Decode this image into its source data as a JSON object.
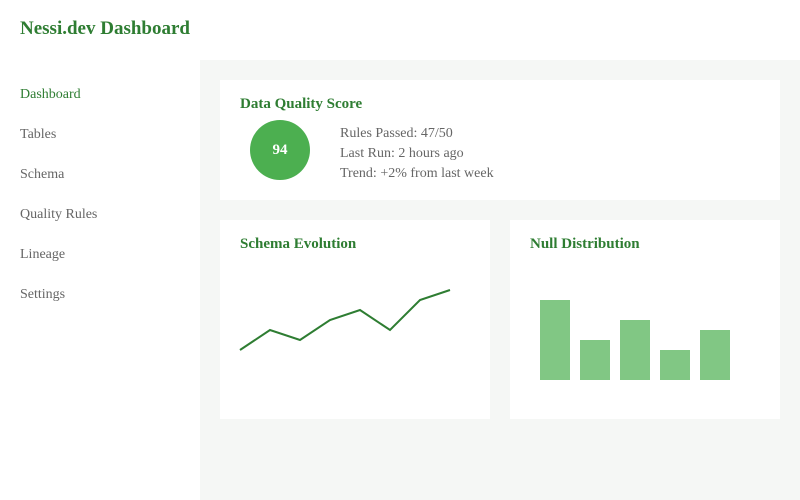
{
  "header": {
    "title": "Nessi.dev Dashboard"
  },
  "sidebar": {
    "items": [
      {
        "label": "Dashboard",
        "active": true
      },
      {
        "label": "Tables",
        "active": false
      },
      {
        "label": "Schema",
        "active": false
      },
      {
        "label": "Quality Rules",
        "active": false
      },
      {
        "label": "Lineage",
        "active": false
      },
      {
        "label": "Settings",
        "active": false
      }
    ]
  },
  "quality": {
    "title": "Data Quality Score",
    "score": "94",
    "rules_passed": "Rules Passed: 47/50",
    "last_run": "Last Run: 2 hours ago",
    "trend": "Trend: +2% from last week"
  },
  "schema_evolution": {
    "title": "Schema Evolution"
  },
  "null_distribution": {
    "title": "Null Distribution"
  },
  "colors": {
    "accent": "#2e7d32",
    "score_fill": "#4caf50",
    "bar_fill": "#81c784",
    "line": "#2e7d32",
    "main_bg": "#f5f7f5"
  },
  "chart_data": [
    {
      "type": "line",
      "x": [
        1,
        2,
        3,
        4,
        5,
        6,
        7,
        8
      ],
      "values": [
        0,
        2,
        1,
        3,
        4,
        2,
        5,
        6
      ]
    },
    {
      "type": "bar",
      "categories": [
        "1",
        "2",
        "3",
        "4",
        "5"
      ],
      "values": [
        8,
        4,
        6,
        3,
        5
      ]
    }
  ]
}
